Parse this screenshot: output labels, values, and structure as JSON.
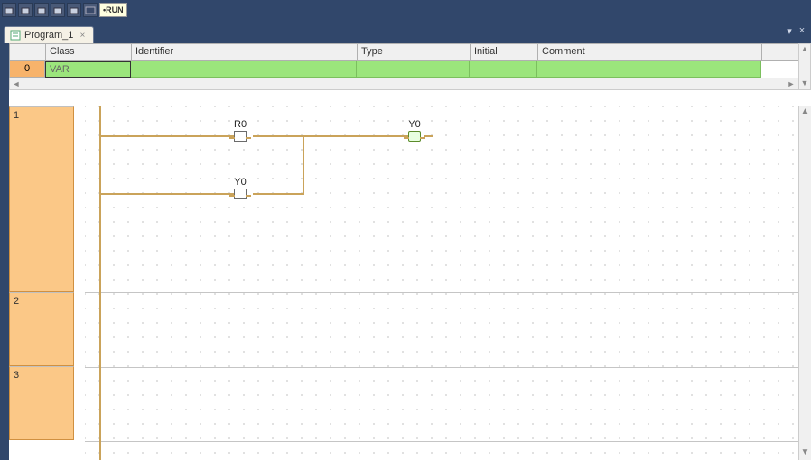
{
  "toolbar": {
    "run_label": "•RUN"
  },
  "tab": {
    "title": "Program_1"
  },
  "var_table": {
    "headers": {
      "class": "Class",
      "identifier": "Identifier",
      "type": "Type",
      "initial": "Initial",
      "comment": "Comment"
    },
    "rows": [
      {
        "index": "0",
        "class": "VAR",
        "identifier": "",
        "type": "",
        "initial": "",
        "comment": ""
      }
    ]
  },
  "ladder": {
    "rungs": [
      "1",
      "2",
      "3"
    ],
    "elements": {
      "contact_top": "R0",
      "contact_bottom": "Y0",
      "coil": "Y0"
    }
  }
}
